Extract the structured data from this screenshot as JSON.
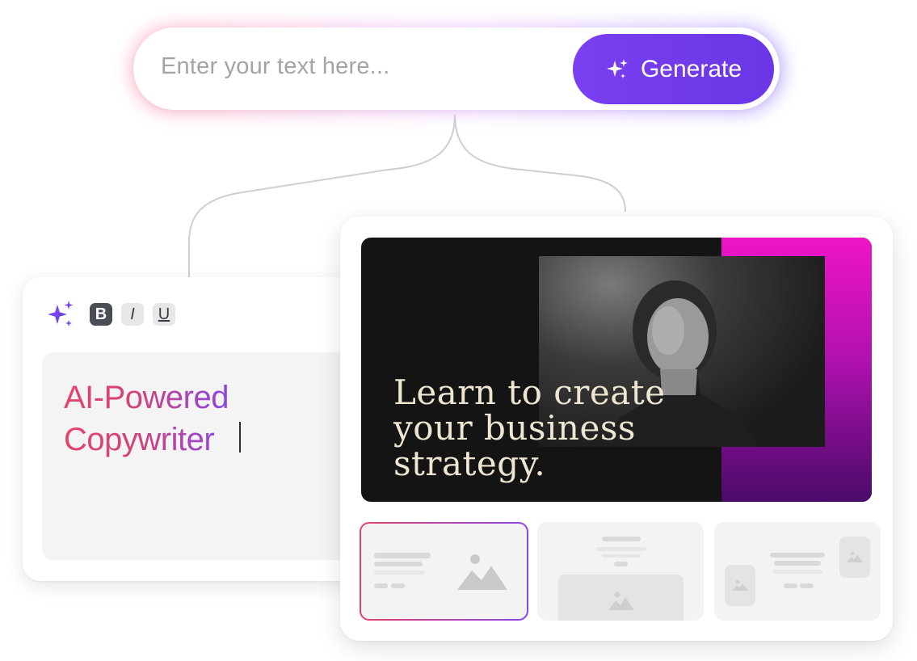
{
  "prompt": {
    "placeholder": "Enter your text here...",
    "generate_label": "Generate"
  },
  "editor": {
    "toolbar": {
      "bold": "B",
      "italic": "I",
      "underline": "U"
    },
    "text_line1": "AI-Powered",
    "text_line2": "Copywriter"
  },
  "design": {
    "headline_line1": "Learn to create",
    "headline_line2": "your business",
    "headline_line3": "strategy."
  },
  "colors": {
    "accent": "#6d38ea",
    "text_gradient_start": "#e5446b",
    "text_gradient_end": "#8a44e8",
    "hero_bg": "#141414",
    "hero_gradient_top": "#ee14c8",
    "hero_gradient_bottom": "#4a0a6a"
  },
  "icons": [
    "sparkle-icon",
    "image-placeholder-icon"
  ]
}
